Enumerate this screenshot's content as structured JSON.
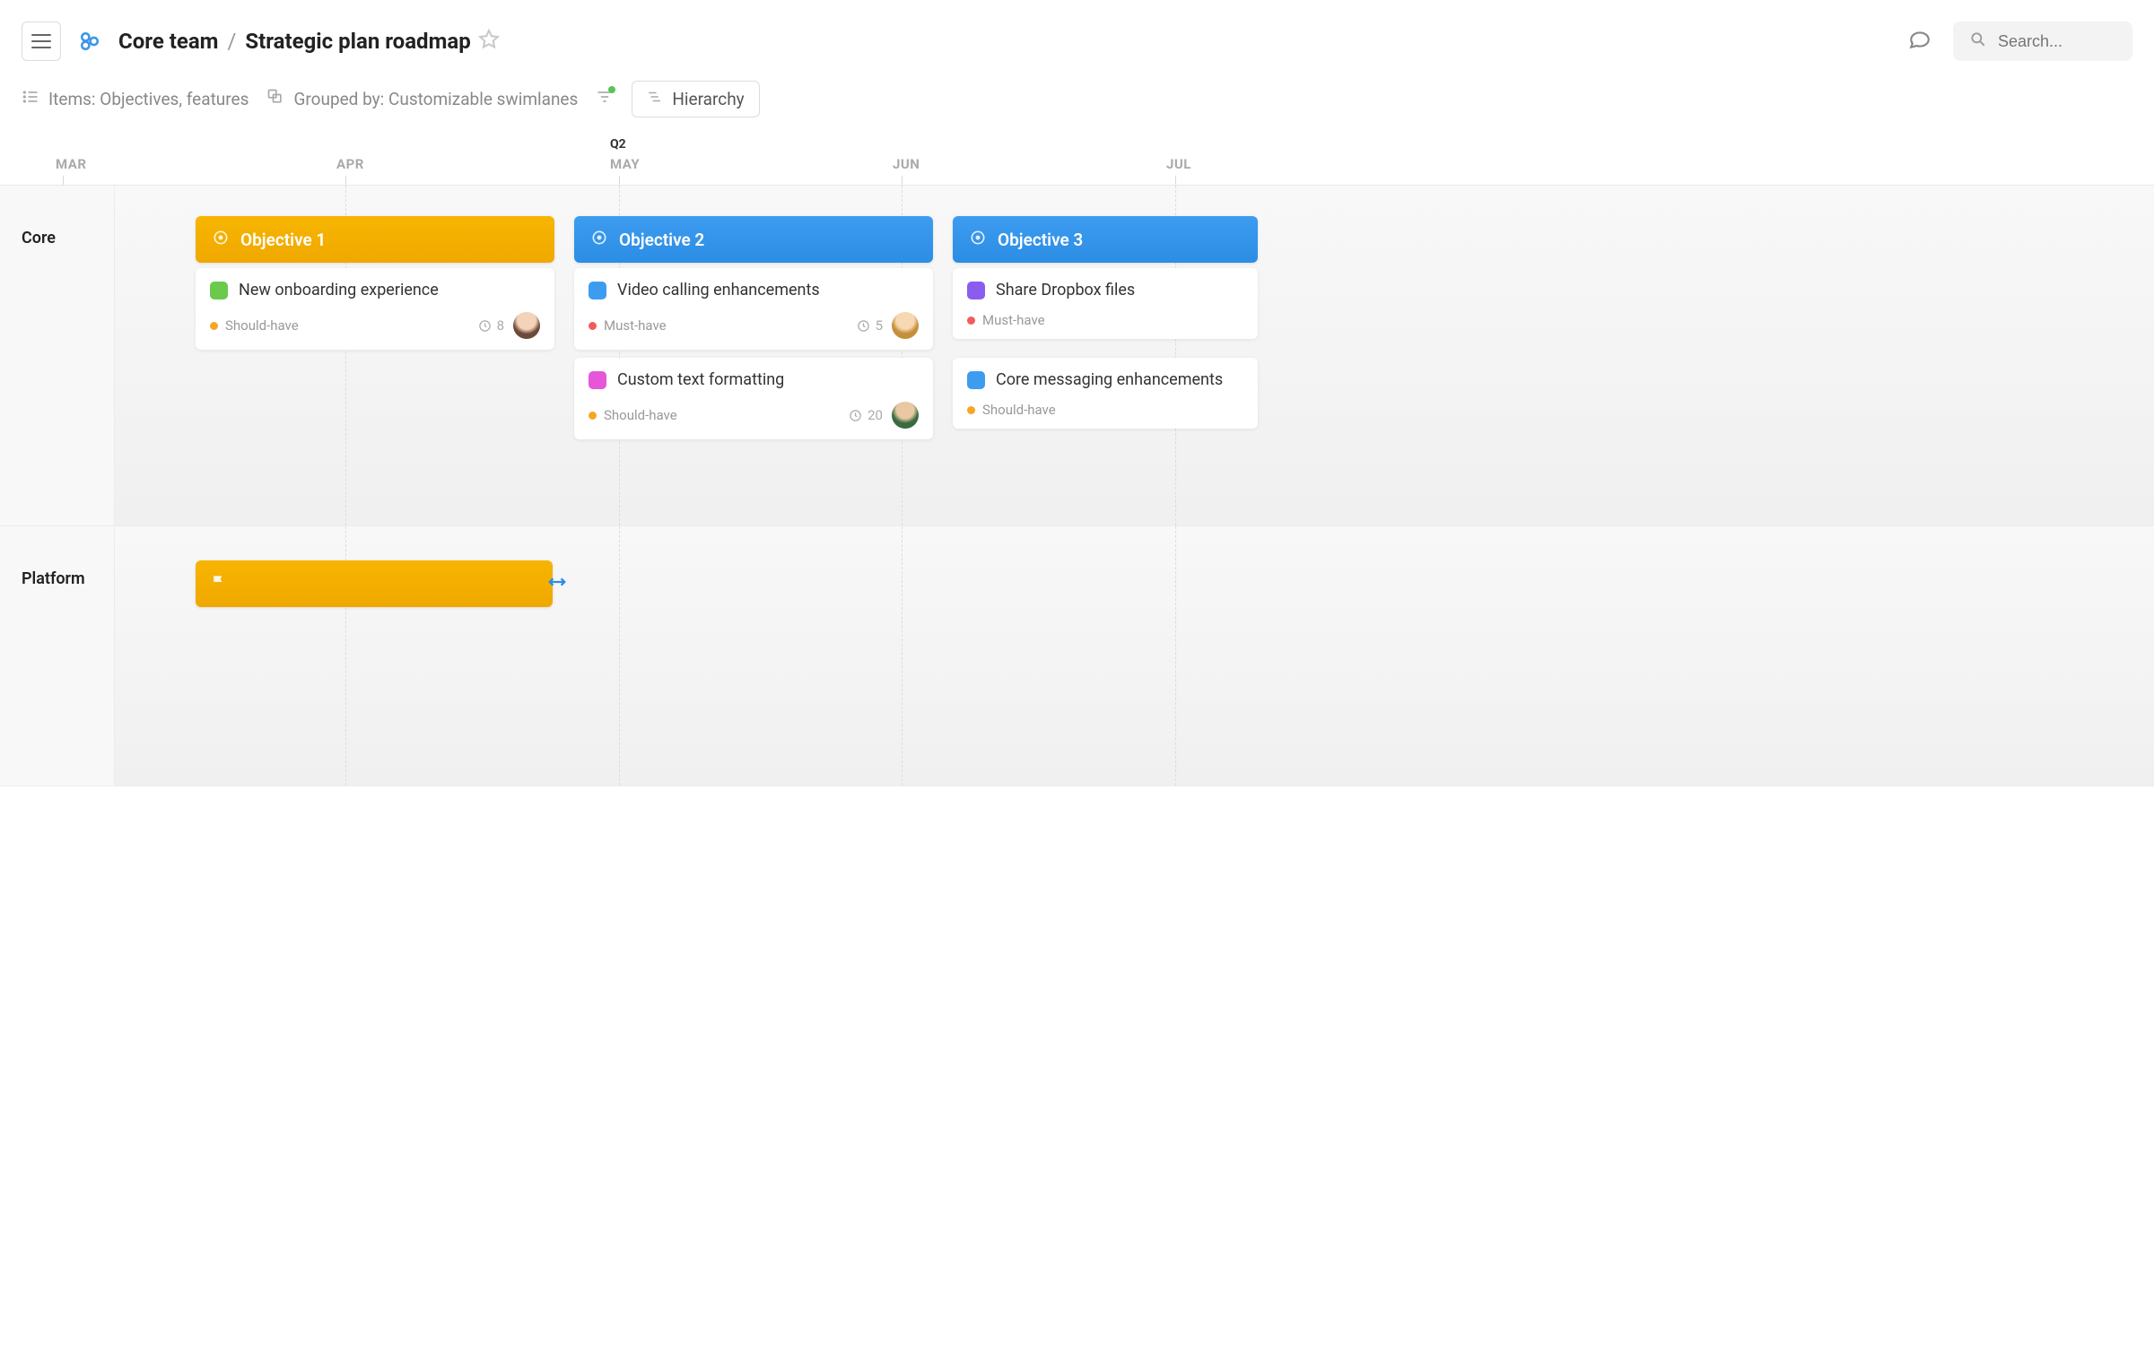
{
  "header": {
    "team": "Core team",
    "page": "Strategic plan roadmap"
  },
  "search": {
    "placeholder": "Search..."
  },
  "toolbar": {
    "items_label": "Items: Objectives, features",
    "grouped_label": "Grouped by: Customizable swimlanes",
    "hierarchy_label": "Hierarchy"
  },
  "timeline": {
    "quarter": "Q2",
    "months": [
      "MAR",
      "APR",
      "MAY",
      "JUN",
      "JUL"
    ]
  },
  "swimlanes": [
    {
      "name": "Core",
      "objectives": [
        {
          "label": "Objective 1",
          "color": "yellow",
          "cards": [
            {
              "title": "New onboarding experience",
              "color": "#6bc94c",
              "priority": "Should-have",
              "priority_color": "#f5a623",
              "effort": "8",
              "avatar": "a1"
            }
          ]
        },
        {
          "label": "Objective 2",
          "color": "blue",
          "cards": [
            {
              "title": "Video calling enhancements",
              "color": "#3d9cf0",
              "priority": "Must-have",
              "priority_color": "#f35b5b",
              "effort": "5",
              "avatar": "a2"
            },
            {
              "title": "Custom text formatting",
              "color": "#e556d8",
              "priority": "Should-have",
              "priority_color": "#f5a623",
              "effort": "20",
              "avatar": "a3"
            }
          ]
        },
        {
          "label": "Objective 3",
          "color": "blue",
          "cards": [
            {
              "title": "Share Dropbox files",
              "color": "#8a5cf0",
              "priority": "Must-have",
              "priority_color": "#f35b5b"
            },
            {
              "title": "Core messaging enhancements",
              "color": "#3d9cf0",
              "priority": "Should-have",
              "priority_color": "#f5a623"
            }
          ]
        }
      ]
    },
    {
      "name": "Platform",
      "objectives": []
    }
  ]
}
